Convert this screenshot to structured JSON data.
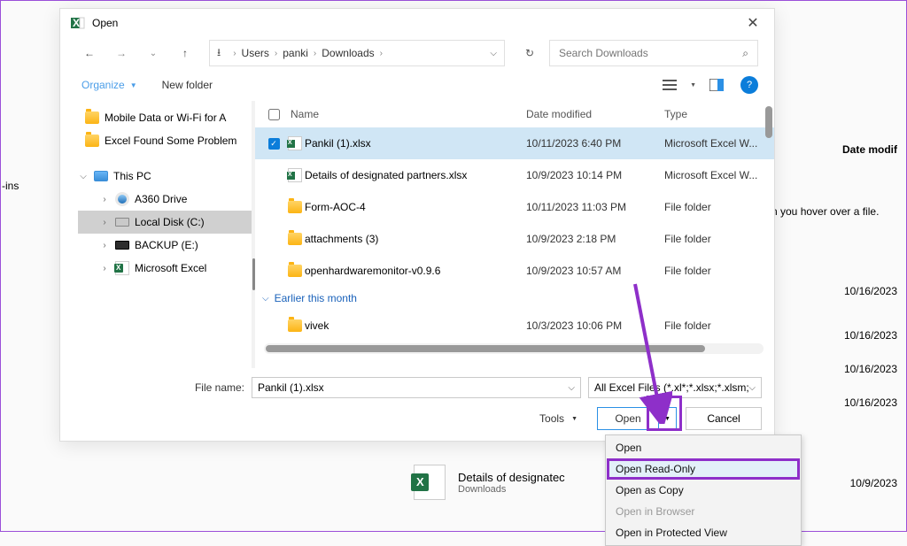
{
  "dialog": {
    "title": "Open",
    "search_placeholder": "Search Downloads"
  },
  "breadcrumbs": [
    "Users",
    "panki",
    "Downloads"
  ],
  "toolbar": {
    "organize": "Organize",
    "new_folder": "New folder"
  },
  "sidebar": {
    "items": [
      {
        "label": "Mobile Data or Wi-Fi for A",
        "icon": "folder"
      },
      {
        "label": "Excel Found Some Problem",
        "icon": "folder"
      }
    ],
    "this_pc": "This PC",
    "drives": [
      {
        "label": "A360 Drive",
        "icon": "a360"
      },
      {
        "label": "Local Disk (C:)",
        "icon": "disk",
        "selected": true
      },
      {
        "label": "BACKUP (E:)",
        "icon": "disk-dark"
      },
      {
        "label": "Microsoft Excel",
        "icon": "excel"
      }
    ]
  },
  "columns": {
    "name": "Name",
    "date": "Date modified",
    "type": "Type"
  },
  "files": [
    {
      "name": "Pankil (1).xlsx",
      "date": "10/11/2023 6:40 PM",
      "type": "Microsoft Excel W...",
      "icon": "excel",
      "selected": true
    },
    {
      "name": "Details of designated partners.xlsx",
      "date": "10/9/2023 10:14 PM",
      "type": "Microsoft Excel W...",
      "icon": "excel"
    },
    {
      "name": "Form-AOC-4",
      "date": "10/11/2023 11:03 PM",
      "type": "File folder",
      "icon": "folder"
    },
    {
      "name": "attachments (3)",
      "date": "10/9/2023 2:18 PM",
      "type": "File folder",
      "icon": "folder"
    },
    {
      "name": "openhardwaremonitor-v0.9.6",
      "date": "10/9/2023 10:57 AM",
      "type": "File folder",
      "icon": "folder"
    }
  ],
  "group_header": "Earlier this month",
  "group_files": [
    {
      "name": "vivek",
      "date": "10/3/2023 10:06 PM",
      "type": "File folder",
      "icon": "folder"
    }
  ],
  "footer": {
    "filename_label": "File name:",
    "filename_value": "Pankil (1).xlsx",
    "filetype_label": "All Excel Files (*.xl*;*.xlsx;*.xlsm;",
    "tools": "Tools",
    "open": "Open",
    "cancel": "Cancel"
  },
  "dropdown": {
    "open": "Open",
    "read_only": "Open Read-Only",
    "as_copy": "Open as Copy",
    "in_browser": "Open in Browser",
    "protected": "Open in Protected View"
  },
  "background": {
    "date_modified_header": "Date modif",
    "addins_label": "-ins",
    "hover_text": "n you hover over a file.",
    "dates": [
      "10/16/2023",
      "10/16/2023",
      "10/16/2023",
      "10/16/2023",
      "10/9/2023"
    ],
    "item_name": "Details of designatec",
    "item_loc": "Downloads"
  }
}
